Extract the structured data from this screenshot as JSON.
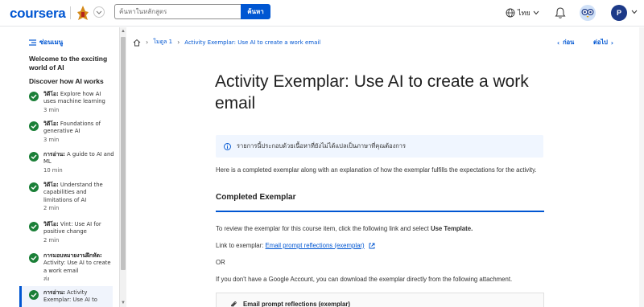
{
  "header": {
    "logo": "coursera",
    "search_placeholder": "ค้นหาในหลักสูตร",
    "search_button": "ค้นหา",
    "language": "ไทย",
    "avatar_initial": "P"
  },
  "sidebar": {
    "hide_menu": "ซ่อนเมนู",
    "module_title": "Welcome to the exciting world of AI",
    "section_title": "Discover how AI works",
    "items": [
      {
        "type": "วิดีโอ:",
        "title": "Explore how AI uses machine learning",
        "duration": "3 min"
      },
      {
        "type": "วิดีโอ:",
        "title": "Foundations of generative AI",
        "duration": "3 min"
      },
      {
        "type": "การอ่าน:",
        "title": "A guide to AI and ML",
        "duration": "10 min"
      },
      {
        "type": "วิดีโอ:",
        "title": "Understand the capabilities and limitations of AI",
        "duration": "2 min"
      },
      {
        "type": "วิดีโอ:",
        "title": "Vint: Use AI for positive change",
        "duration": "2 min"
      },
      {
        "type": "การมอบหมายงานฝึกหัด:",
        "title": "Activity: Use AI to create a work email",
        "duration": "ส่ง"
      },
      {
        "type": "การอ่าน:",
        "title": "Activity Exemplar: Use AI to",
        "duration": ""
      }
    ]
  },
  "breadcrumb": {
    "module": "โมดูล 1",
    "current": "Activity Exemplar: Use AI to create a work email"
  },
  "nav": {
    "prev": "ก่อน",
    "next": "ต่อไป"
  },
  "main": {
    "title": "Activity Exemplar: Use AI to create a work email",
    "notice": "รายการนี้ประกอบด้วยเนื้อหาที่ยังไม่ได้แปลเป็นภาษาที่คุณต้องการ",
    "intro": "Here is a completed exemplar along with an explanation of how the exemplar fulfills the expectations for the activity.",
    "heading": "Completed Exemplar",
    "review_text": "To review the exemplar for this course item, click the following link and select ",
    "review_bold": "Use Template.",
    "link_label": "Link to exemplar: ",
    "link_text": "Email prompt reflections (exemplar)",
    "or": "OR",
    "download_text": "If you don't have a Google Account, you can download the exemplar directly from the following attachment.",
    "attachment_name": "Email prompt reflections (exemplar)"
  },
  "colors": {
    "brand": "#0056d2",
    "complete": "#1a7f37"
  }
}
